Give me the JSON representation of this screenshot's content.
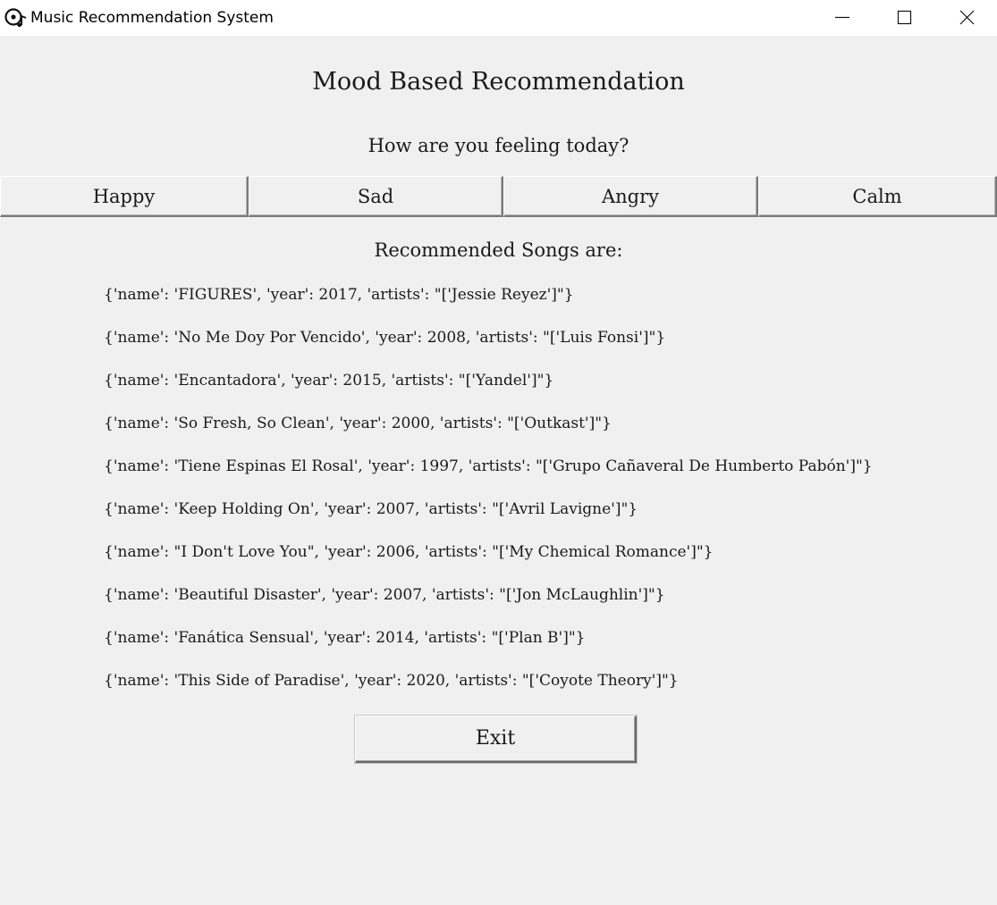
{
  "window": {
    "title": "Music Recommendation System",
    "icon": "music-disc-icon",
    "controls": [
      "minimize-icon",
      "maximize-icon",
      "close-icon"
    ]
  },
  "main": {
    "heading": "Mood Based Recommendation",
    "question": "How are you feeling today?",
    "moods": [
      {
        "label": "Happy"
      },
      {
        "label": "Sad"
      },
      {
        "label": "Angry"
      },
      {
        "label": "Calm"
      }
    ],
    "recommended_heading": "Recommended Songs are:",
    "songs": [
      "{'name': 'FIGURES', 'year': 2017, 'artists': \"['Jessie Reyez']\"}",
      "{'name': 'No Me Doy Por Vencido', 'year': 2008, 'artists': \"['Luis Fonsi']\"}",
      "{'name': 'Encantadora', 'year': 2015, 'artists': \"['Yandel']\"}",
      "{'name': 'So Fresh, So Clean', 'year': 2000, 'artists': \"['Outkast']\"}",
      "{'name': 'Tiene Espinas El Rosal', 'year': 1997, 'artists': \"['Grupo Cañaveral De Humberto Pabón']\"}",
      "{'name': 'Keep Holding On', 'year': 2007, 'artists': \"['Avril Lavigne']\"}",
      "{'name': \"I Don't Love You\", 'year': 2006, 'artists': \"['My Chemical Romance']\"}",
      "{'name': 'Beautiful Disaster', 'year': 2007, 'artists': \"['Jon McLaughlin']\"}",
      "{'name': 'Fanática Sensual', 'year': 2014, 'artists': \"['Plan B']\"}",
      "{'name': 'This Side of Paradise', 'year': 2020, 'artists': \"['Coyote Theory']\"}"
    ],
    "exit_label": "Exit"
  },
  "colors": {
    "background": "#f0f0f0",
    "titlebar": "#ffffff",
    "text": "#1a1a1a"
  }
}
